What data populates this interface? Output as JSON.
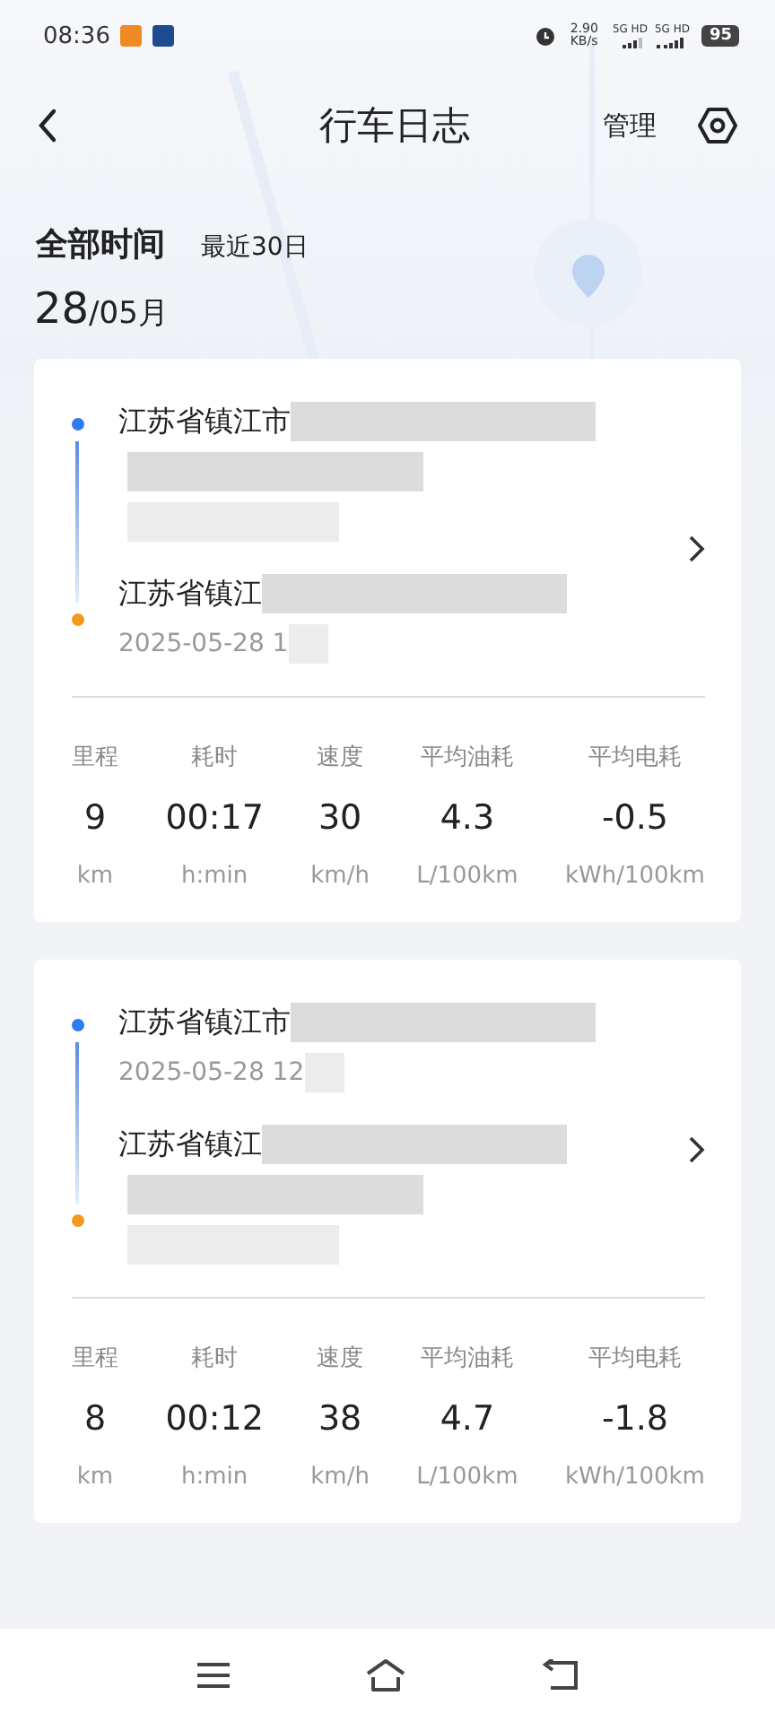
{
  "status_bar": {
    "time": "08:36",
    "net_speed": "2.90",
    "net_unit": "KB/s",
    "signal_1": "5G HD",
    "signal_2": "5G HD",
    "battery": "95"
  },
  "header": {
    "title": "行车日志",
    "manage": "管理"
  },
  "filters": [
    {
      "label": "全部时间",
      "selected": true
    },
    {
      "label": "最近30日",
      "selected": false
    }
  ],
  "date": {
    "day": "28",
    "month": "/05月"
  },
  "trips": [
    {
      "start": {
        "address": "江苏省镇江市",
        "kind": "redacted"
      },
      "end": {
        "address": "江苏省镇江",
        "kind": "time",
        "time": "2025-05-28 1"
      },
      "stats": [
        {
          "label": "里程",
          "value": "9",
          "unit": "km"
        },
        {
          "label": "耗时",
          "value": "00:17",
          "unit": "h:min"
        },
        {
          "label": "速度",
          "value": "30",
          "unit": "km/h"
        },
        {
          "label": "平均油耗",
          "value": "4.3",
          "unit": "L/100km"
        },
        {
          "label": "平均电耗",
          "value": "-0.5",
          "unit": "kWh/100km"
        }
      ]
    },
    {
      "start": {
        "address": "江苏省镇江市",
        "kind": "time",
        "time": "2025-05-28 12"
      },
      "end": {
        "address": "江苏省镇江",
        "kind": "redacted"
      },
      "stats": [
        {
          "label": "里程",
          "value": "8",
          "unit": "km"
        },
        {
          "label": "耗时",
          "value": "00:12",
          "unit": "h:min"
        },
        {
          "label": "速度",
          "value": "38",
          "unit": "km/h"
        },
        {
          "label": "平均油耗",
          "value": "4.7",
          "unit": "L/100km"
        },
        {
          "label": "平均电耗",
          "value": "-1.8",
          "unit": "kWh/100km"
        }
      ]
    }
  ]
}
